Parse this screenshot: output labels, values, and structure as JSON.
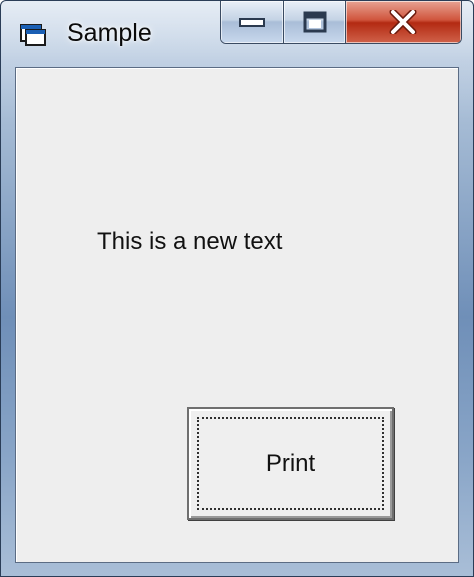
{
  "window": {
    "title": "Sample",
    "icon": "app-window-icon"
  },
  "caption_buttons": {
    "minimize_icon": "minimize-icon",
    "maximize_icon": "maximize-icon",
    "close_icon": "close-icon",
    "close_color": "#c4321a"
  },
  "form": {
    "label_text": "This is a new text",
    "button_label": "Print",
    "background_color": "#eeeeee"
  }
}
